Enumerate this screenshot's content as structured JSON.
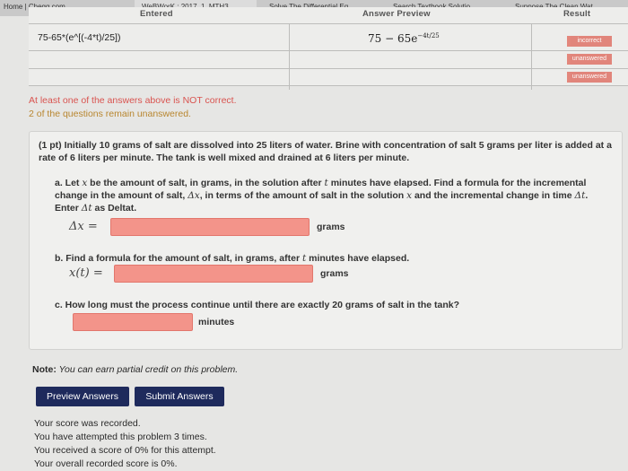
{
  "browser": {
    "tabs": [
      {
        "label": "Home | Chegg.com",
        "active": false
      },
      {
        "label": "WeBWorK : 2017_1_MTH3...",
        "active": true
      },
      {
        "label": "Solve The Differential Eq...",
        "active": false
      },
      {
        "label": "Search Textbook Solutio...",
        "active": false
      },
      {
        "label": "Suppose The Clean Wat...",
        "active": false
      }
    ]
  },
  "results_table": {
    "headers": {
      "entered": "Entered",
      "preview": "Answer Preview",
      "result": "Result"
    },
    "row1": {
      "entered": "75-65*(e^[(-4*t)/25])",
      "preview_base": "75 − 65e",
      "preview_exp": "−4t/25",
      "result": "incorrect"
    },
    "row2": {
      "result": "unanswered"
    },
    "row3": {
      "result": "unanswered"
    }
  },
  "messages": {
    "not_correct": "At least one of the answers above is NOT correct.",
    "unanswered": "2 of the questions remain unanswered."
  },
  "problem": {
    "intro": "(1 pt) Initially 10 grams of salt are dissolved into 25 liters of water. Brine with concentration of salt 5 grams per liter is added at a rate of 6 liters per minute. The tank is well mixed and drained at 6 liters per minute.",
    "part_a": {
      "text_1": "a. Let ",
      "var_x": "x",
      "text_2": " be the amount of salt, in grams, in the solution after ",
      "var_t": "t",
      "text_3": " minutes have elapsed. Find a formula for the incremental change in the amount of salt, ",
      "delta_x": "Δx",
      "text_4": ", in terms of the amount of salt in the solution ",
      "var_x2": "x",
      "text_5": " and the incremental change in time ",
      "delta_t": "Δt",
      "text_6": ". Enter ",
      "delta_t2": "Δt",
      "text_7": " as Deltat.",
      "label": "Δx =",
      "value": "",
      "unit": "grams"
    },
    "part_b": {
      "text_1": "b. Find a formula for the amount of salt, in grams, after ",
      "var_t": "t",
      "text_2": " minutes have elapsed.",
      "label": "x(t) =",
      "value": "",
      "unit": "grams"
    },
    "part_c": {
      "text": "c. How long must the process continue until there are exactly 20 grams of salt in the tank?",
      "value": "",
      "unit": "minutes"
    }
  },
  "note": {
    "label": "Note:",
    "text": " You can earn partial credit on this problem."
  },
  "buttons": {
    "preview": "Preview Answers",
    "submit": "Submit Answers"
  },
  "status": {
    "recorded": "Your score was recorded.",
    "attempts": "You have attempted this problem 3 times.",
    "attempt_score": "You received a score of 0% for this attempt.",
    "overall": "Your overall recorded score is 0%."
  },
  "colors": {
    "incorrect": "#f3948a",
    "button": "#1e2a5c",
    "warning_text": "#d9534f"
  }
}
